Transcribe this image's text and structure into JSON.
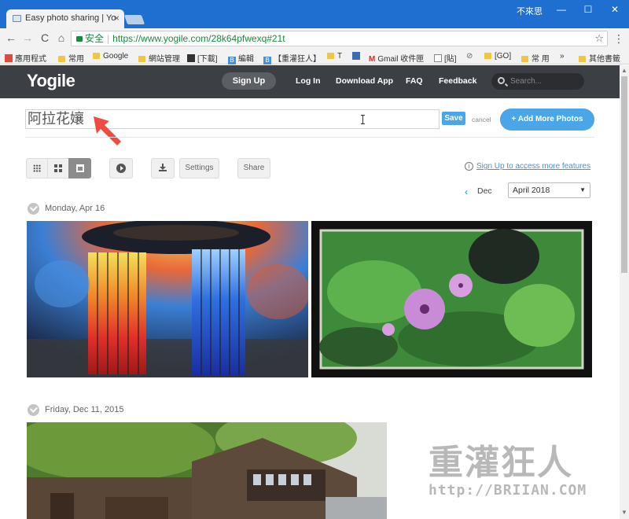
{
  "browser": {
    "tab_title": "Easy photo sharing | Yo",
    "tab_close": "×",
    "user_label": "不來思",
    "win_min": "—",
    "win_max": "☐",
    "win_close": "✕",
    "secure_label": "安全",
    "url": "https://www.yogile.com/28k64pfwexq#21t",
    "back": "←",
    "forward": "→",
    "reload": "C",
    "home": "⌂",
    "star": "☆",
    "menu": "⋮"
  },
  "bookmarks": [
    {
      "label": "應用程式",
      "icon": "apps-icon"
    },
    {
      "label": "常用",
      "icon": "folder-icon"
    },
    {
      "label": "Google",
      "icon": "folder-icon"
    },
    {
      "label": "網站管理",
      "icon": "folder-icon"
    },
    {
      "label": "[下載]",
      "icon": "site-icon"
    },
    {
      "label": "編輯",
      "icon": "b-icon"
    },
    {
      "label": "【重灌狂人】",
      "icon": "b-icon"
    },
    {
      "label": "T",
      "icon": "folder-icon"
    },
    {
      "label": "Gmail 收件匣",
      "icon": "gmail-icon"
    },
    {
      "label": "[貼]",
      "icon": "page-icon"
    },
    {
      "label": "[GO]",
      "icon": "folder-icon"
    },
    {
      "label": "常 用",
      "icon": "folder-icon"
    },
    {
      "label": "»",
      "icon": ""
    },
    {
      "label": "其他書籤",
      "icon": "folder-icon"
    }
  ],
  "site": {
    "logo": "Yogile",
    "signup": "Sign Up",
    "nav": [
      "Log In",
      "Download App",
      "FAQ",
      "Feedback"
    ],
    "search_placeholder": "Search..."
  },
  "album": {
    "title": "阿拉花孃",
    "save": "Save",
    "cancel": "cancel",
    "add_more": "+ Add More Photos"
  },
  "toolbar": {
    "settings": "Settings",
    "share": "Share",
    "signup_link": "Sign Up to access more features",
    "info": "i",
    "prev_icon": "‹",
    "prev_label": "Dec",
    "month": "April 2018",
    "caret": "▼"
  },
  "days": [
    {
      "label": "Monday, Apr 16"
    },
    {
      "label": "Friday, Dec 11, 2015"
    }
  ],
  "watermark": {
    "chinese": "重灌狂人",
    "url": "http://BRIIAN.COM"
  },
  "colors": {
    "accent": "#4aa6e8",
    "header": "#3c3f44",
    "chrome": "#1f6fd0"
  }
}
